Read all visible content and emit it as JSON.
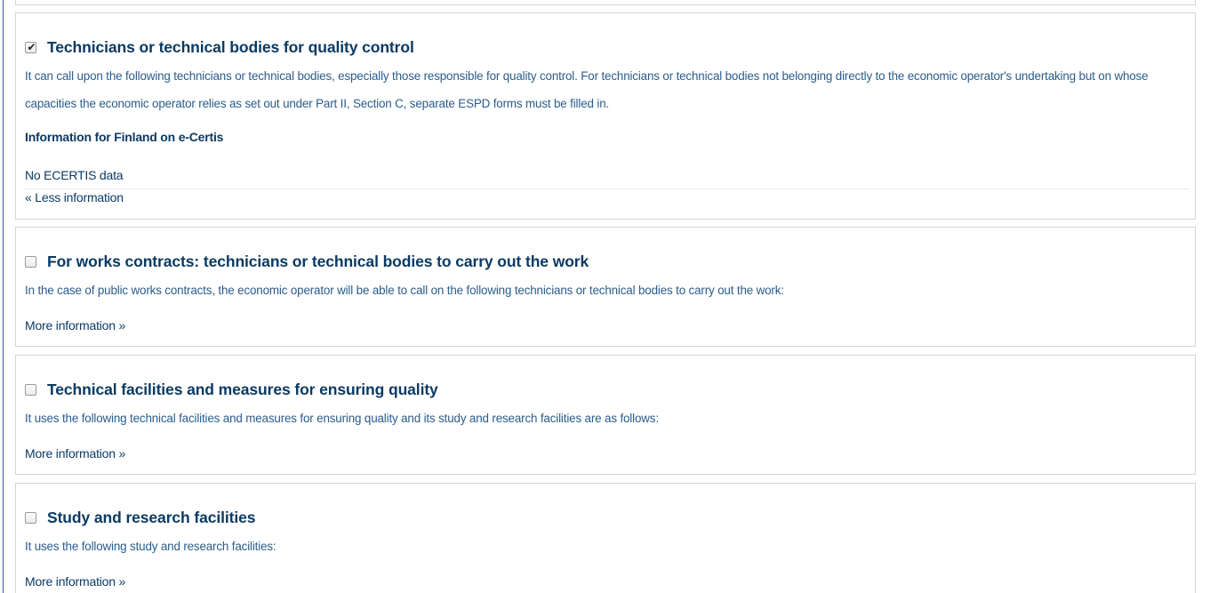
{
  "criteria": [
    {
      "title": "Technicians or technical bodies for quality control",
      "checked": true,
      "description": "It can call upon the following technicians or technical bodies, especially those responsible for quality control. For technicians or technical bodies not belonging directly to the economic operator's undertaking but on whose capacities the economic operator relies as set out under Part II, Section C, separate ESPD forms must be filled in.",
      "info_heading": "Information for Finland on e-Certis",
      "info_text": "No ECERTIS data",
      "toggle_label": "« Less information"
    },
    {
      "title": "For works contracts: technicians or technical bodies to carry out the work",
      "checked": false,
      "description": "In the case of public works contracts, the economic operator will be able to call on the following technicians or technical bodies to carry out the work:",
      "toggle_label": "More information »"
    },
    {
      "title": "Technical facilities and measures for ensuring quality",
      "checked": false,
      "description": "It uses the following technical facilities and measures for ensuring quality and its study and research facilities are as follows:",
      "toggle_label": "More information »"
    },
    {
      "title": "Study and research facilities",
      "checked": false,
      "description": "It uses the following study and research facilities:",
      "toggle_label": "More information »"
    }
  ],
  "checkmark_glyph": "✔",
  "colors": {
    "title": "#0b3a63",
    "description": "#2a5c8c",
    "border": "#d4d4d4",
    "page_rule": "#2e5f95"
  }
}
